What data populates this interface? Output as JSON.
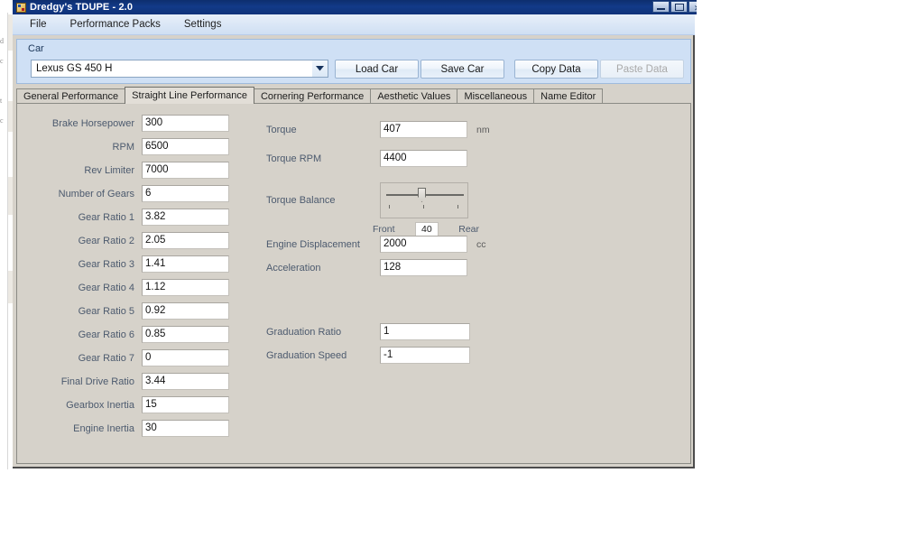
{
  "window": {
    "title": "Dredgy's TDUPE - 2.0",
    "icon": "app-icon",
    "controls": {
      "minimize": "minimize-button",
      "maximize": "maximize-button",
      "close": "close-button"
    }
  },
  "menu": {
    "items": [
      {
        "label": "File"
      },
      {
        "label": "Performance Packs"
      },
      {
        "label": "Settings"
      }
    ]
  },
  "car_panel": {
    "legend": "Car",
    "selected_car": "Lexus GS 450 H",
    "buttons": [
      {
        "label": "Load Car",
        "disabled": false
      },
      {
        "label": "Save Car",
        "disabled": false
      },
      {
        "label": "Copy Data",
        "disabled": false
      },
      {
        "label": "Paste Data",
        "disabled": true
      }
    ]
  },
  "tabs": [
    {
      "label": "General Performance",
      "active": false
    },
    {
      "label": "Straight Line Performance",
      "active": true
    },
    {
      "label": "Cornering Performance",
      "active": false
    },
    {
      "label": "Aesthetic Values",
      "active": false
    },
    {
      "label": "Miscellaneous",
      "active": false
    },
    {
      "label": "Name Editor",
      "active": false
    }
  ],
  "left_column": [
    {
      "label": "Brake Horsepower",
      "value": "300"
    },
    {
      "label": "RPM",
      "value": "6500"
    },
    {
      "label": "Rev Limiter",
      "value": "7000"
    },
    {
      "label": "Number of Gears",
      "value": "6"
    },
    {
      "label": "Gear Ratio 1",
      "value": "3.82"
    },
    {
      "label": "Gear Ratio 2",
      "value": "2.05"
    },
    {
      "label": "Gear Ratio 3",
      "value": "1.41"
    },
    {
      "label": "Gear Ratio 4",
      "value": "1.12"
    },
    {
      "label": "Gear Ratio 5",
      "value": "0.92"
    },
    {
      "label": "Gear Ratio 6",
      "value": "0.85"
    },
    {
      "label": "Gear Ratio 7",
      "value": "0"
    },
    {
      "label": "Final Drive Ratio",
      "value": "3.44"
    },
    {
      "label": "Gearbox Inertia",
      "value": "15"
    },
    {
      "label": "Engine Inertia",
      "value": "30"
    }
  ],
  "right_column": {
    "torque": {
      "label": "Torque",
      "value": "407",
      "unit": "nm"
    },
    "torque_rpm": {
      "label": "Torque RPM",
      "value": "4400",
      "unit": ""
    },
    "torque_balance": {
      "label": "Torque Balance",
      "value": "40",
      "front_label": "Front",
      "rear_label": "Rear",
      "min": 0,
      "max": 100
    },
    "engine_displacement": {
      "label": "Engine Displacement",
      "value": "2000",
      "unit": "cc"
    },
    "acceleration": {
      "label": "Acceleration",
      "value": "128",
      "unit": ""
    },
    "graduation_ratio": {
      "label": "Graduation Ratio",
      "value": "1",
      "unit": ""
    },
    "graduation_speed": {
      "label": "Graduation Speed",
      "value": "-1",
      "unit": ""
    }
  },
  "colors": {
    "title_bar": "#0f3279",
    "menu_bar": "#dbe7f6",
    "car_panel": "#cfe0f5",
    "content": "#d6d2ca",
    "label_text": "#4c5a6e",
    "field_bg": "#ffffff"
  }
}
